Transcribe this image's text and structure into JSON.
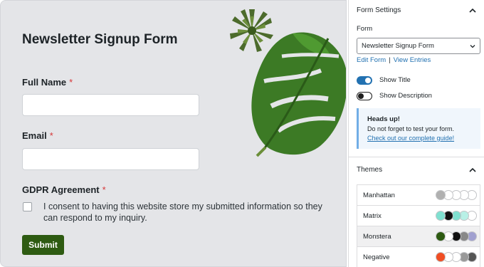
{
  "form": {
    "title": "Newsletter Signup Form",
    "full_name_label": "Full Name",
    "email_label": "Email",
    "gdpr_label": "GDPR Agreement",
    "required_mark": "*",
    "consent_text": "I consent to having this website store my submitted information so they can respond to my inquiry.",
    "submit_label": "Submit"
  },
  "panel": {
    "section_title": "Form Settings",
    "form_label": "Form",
    "form_selected": "Newsletter Signup Form",
    "edit_form_link": "Edit Form",
    "separator": "|",
    "view_entries_link": "View Entries",
    "show_title": {
      "label": "Show Title",
      "on": true
    },
    "show_description": {
      "label": "Show Description",
      "on": false
    },
    "notice": {
      "title": "Heads up!",
      "text": "Do not forget to test your form.",
      "link": "Check out our complete guide!"
    },
    "themes_title": "Themes",
    "themes": [
      {
        "name": "Manhattan",
        "colors": [
          "#b0b0b0",
          "#ffffff",
          "#ffffff",
          "#ffffff",
          "#ffffff"
        ],
        "selected": false
      },
      {
        "name": "Matrix",
        "colors": [
          "#7fe0d0",
          "#111111",
          "#7fe0d0",
          "#b8f0e6",
          "#ffffff"
        ],
        "selected": false
      },
      {
        "name": "Monstera",
        "colors": [
          "#2e5b12",
          "#ffffff",
          "#111111",
          "#888888",
          "#a0a0d0"
        ],
        "selected": true
      },
      {
        "name": "Negative",
        "colors": [
          "#f04e23",
          "#ffffff",
          "#ffffff",
          "#999999",
          "#555555"
        ],
        "selected": false
      }
    ]
  }
}
